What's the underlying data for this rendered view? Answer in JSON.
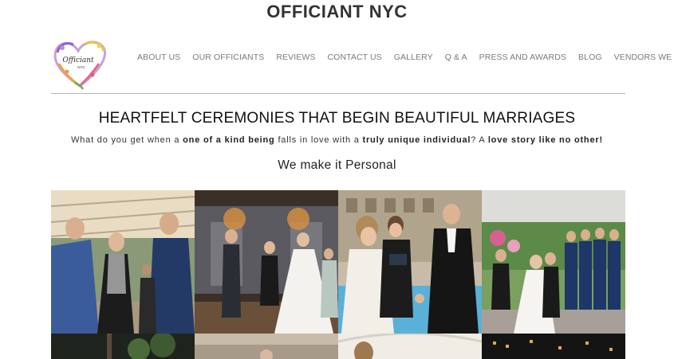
{
  "site": {
    "title": "OFFICIANT NYC"
  },
  "logo": {
    "script_text": "Officiant",
    "sub_text": "NYC"
  },
  "nav": {
    "items": [
      {
        "label": "ABOUT US"
      },
      {
        "label": "OUR OFFICIANTS"
      },
      {
        "label": "REVIEWS"
      },
      {
        "label": "CONTACT US"
      },
      {
        "label": "GALLERY"
      },
      {
        "label": "Q & A"
      },
      {
        "label": "PRESS AND AWARDS"
      },
      {
        "label": "BLOG"
      },
      {
        "label": "VENDORS WE LOVE"
      }
    ]
  },
  "hero": {
    "heading": "HEARTFELT CEREMONIES THAT BEGIN BEAUTIFUL MARRIAGES",
    "tagline": {
      "t1": "What do you get when a ",
      "b1": "one of a kind being",
      "t2": " falls in love with a ",
      "b2": "truly unique individual",
      "t3": "?  A ",
      "b3": "love story like no other!"
    },
    "subheading": "We make it Personal"
  }
}
